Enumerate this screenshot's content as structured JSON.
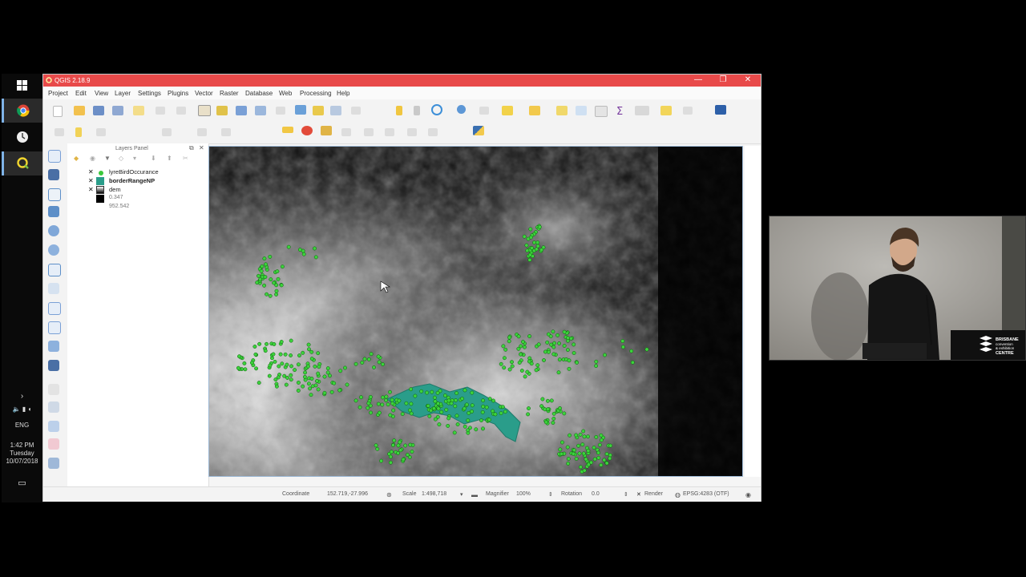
{
  "window": {
    "title": "QGIS 2.18.9",
    "controls": {
      "minimize": "—",
      "maximize": "❐",
      "close": "✕"
    }
  },
  "menu": [
    "Project",
    "Edit",
    "View",
    "Layer",
    "Settings",
    "Plugins",
    "Vector",
    "Raster",
    "Database",
    "Web",
    "Processing",
    "Help"
  ],
  "layers_panel": {
    "title": "Layers Panel",
    "layers": [
      {
        "name": "lyreBirdOccurance",
        "checked": true,
        "symbol_color": "#3cc83c"
      },
      {
        "name": "borderRangeNP",
        "checked": true,
        "symbol_color": "#2a9d8a"
      },
      {
        "name": "dem",
        "checked": true,
        "symbol_color": "#000000"
      }
    ],
    "dem_min": "0.347",
    "dem_max": "952.542"
  },
  "status": {
    "coordinate_label": "Coordinate",
    "coordinate_value": "152.719,-27.996",
    "scale_label": "Scale",
    "scale_value": "1:498,718",
    "magnifier_label": "Magnifier",
    "magnifier_value": "100%",
    "rotation_label": "Rotation",
    "rotation_value": "0.0",
    "render_label": "Render",
    "crs": "EPSG:4283 (OTF)"
  },
  "taskbar": {
    "lang": "ENG",
    "time": "1:42 PM",
    "day": "Tuesday",
    "date": "10/07/2018"
  },
  "webcam": {
    "logo_line1": "BRISBANE",
    "logo_line2": "convention",
    "logo_line3": "& exhibition",
    "logo_line4": "CENTRE"
  },
  "colors": {
    "titlebar": "#e84a4a",
    "point": "#3cd23c",
    "polygon": "#2a9d8a",
    "canvas_bg": "#000000"
  }
}
